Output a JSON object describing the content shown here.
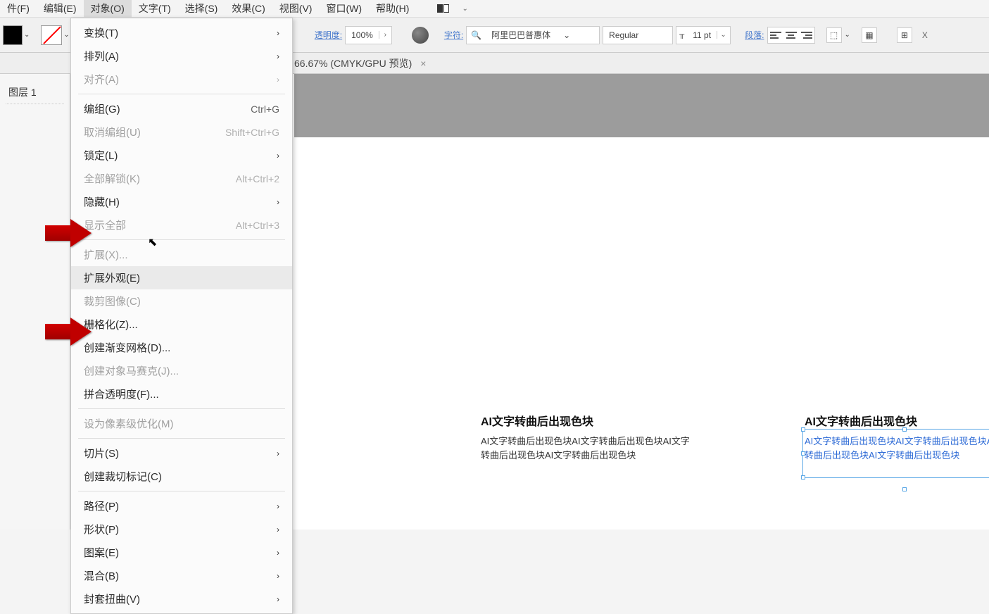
{
  "menubar": {
    "items": [
      {
        "label": "件(F)"
      },
      {
        "label": "编辑(E)"
      },
      {
        "label": "对象(O)",
        "active": true
      },
      {
        "label": "文字(T)"
      },
      {
        "label": "选择(S)"
      },
      {
        "label": "效果(C)"
      },
      {
        "label": "视图(V)"
      },
      {
        "label": "窗口(W)"
      },
      {
        "label": "帮助(H)"
      }
    ]
  },
  "dropdown": {
    "items": [
      {
        "label": "变换(T)",
        "arrow": true
      },
      {
        "label": "排列(A)",
        "arrow": true
      },
      {
        "label": "对齐(A)",
        "arrow": true,
        "disabled": true
      },
      {
        "sep": true
      },
      {
        "label": "编组(G)",
        "shortcut": "Ctrl+G"
      },
      {
        "label": "取消编组(U)",
        "shortcut": "Shift+Ctrl+G",
        "disabled": true
      },
      {
        "label": "锁定(L)",
        "arrow": true
      },
      {
        "label": "全部解锁(K)",
        "shortcut": "Alt+Ctrl+2",
        "disabled": true
      },
      {
        "label": "隐藏(H)",
        "arrow": true
      },
      {
        "label": "显示全部",
        "shortcut": "Alt+Ctrl+3",
        "disabled": true
      },
      {
        "sep": true
      },
      {
        "label": "扩展(X)...",
        "disabled": true
      },
      {
        "label": "扩展外观(E)",
        "hover": true
      },
      {
        "label": "裁剪图像(C)",
        "disabled": true
      },
      {
        "label": "栅格化(Z)..."
      },
      {
        "label": "创建渐变网格(D)..."
      },
      {
        "label": "创建对象马赛克(J)...",
        "disabled": true
      },
      {
        "label": "拼合透明度(F)..."
      },
      {
        "sep": true
      },
      {
        "label": "设为像素级优化(M)",
        "disabled": true
      },
      {
        "sep": true
      },
      {
        "label": "切片(S)",
        "arrow": true
      },
      {
        "label": "创建裁切标记(C)"
      },
      {
        "sep": true
      },
      {
        "label": "路径(P)",
        "arrow": true
      },
      {
        "label": "形状(P)",
        "arrow": true
      },
      {
        "label": "图案(E)",
        "arrow": true
      },
      {
        "label": "混合(B)",
        "arrow": true
      },
      {
        "label": "封套扭曲(V)",
        "arrow": true
      }
    ]
  },
  "toolbar": {
    "opacity_label": "透明度:",
    "opacity_value": "100%",
    "char_label": "字符:",
    "font_name": "阿里巴巴普惠体",
    "font_style": "Regular",
    "font_size": "11 pt",
    "paragraph_label": "段落:",
    "x_label": "X"
  },
  "tab": {
    "title": " 66.67% (CMYK/GPU 预览)",
    "close": "×"
  },
  "side": {
    "layer": "图层 1"
  },
  "canvas": {
    "block1": {
      "title": "AI文字转曲后出现色块",
      "body": "AI文字转曲后出现色块AI文字转曲后出现色块AI文字转曲后出现色块AI文字转曲后出现色块"
    },
    "block2": {
      "title": "AI文字转曲后出现色块",
      "body": "AI文字转曲后出现色块AI文字转曲后出现色块AI文字转曲后出现色块AI文字转曲后出现色块"
    }
  }
}
